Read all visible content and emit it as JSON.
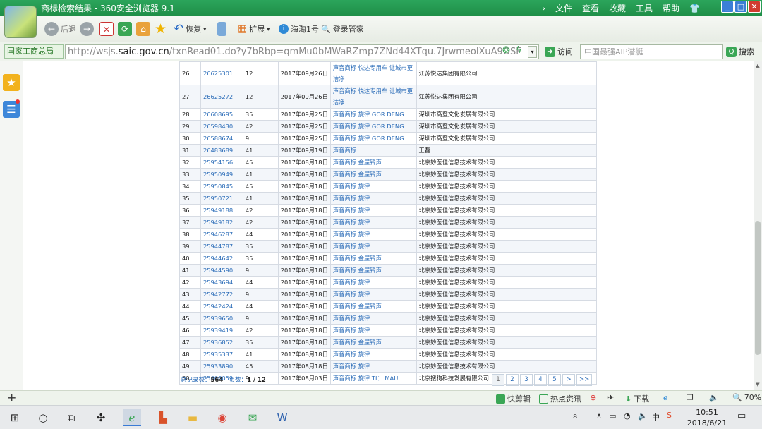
{
  "window": {
    "title": "商标检索结果 - 360安全浏览器 9.1",
    "menus": [
      "文件",
      "查看",
      "收藏",
      "工具",
      "帮助"
    ]
  },
  "toolbar": {
    "back": "后退",
    "restore": "恢复",
    "extend": "扩展",
    "haitao": "海淘1号",
    "login": "登录管家"
  },
  "address": {
    "site_tag": "国家工商总局",
    "url_prefix": "http://wsjs.",
    "url_domain": "saic.gov.cn",
    "url_rest": "/txnRead01.do?y7bRbp=qmMu0bMWaRZmp7ZNd44XTqu.7JrwmeolXuA9OSF",
    "visit": "访问",
    "search_placeholder": "中国最强AIP潜艇",
    "search_button": "搜索"
  },
  "rows": [
    {
      "no": "26",
      "reg": "26625301",
      "cls": "12",
      "date": "2017年09月26日",
      "name": "声音商标 悦达专用车 让城市更洁净",
      "applicant": "江苏悦达集团有限公司",
      "tall": true
    },
    {
      "no": "27",
      "reg": "26625272",
      "cls": "12",
      "date": "2017年09月26日",
      "name": "声音商标 悦达专用车 让城市更洁净",
      "applicant": "江苏悦达集团有限公司",
      "tall": true
    },
    {
      "no": "28",
      "reg": "26608695",
      "cls": "35",
      "date": "2017年09月25日",
      "name": "声音商标 旋律 GOR DENG",
      "applicant": "深圳市高登文化发展有限公司"
    },
    {
      "no": "29",
      "reg": "26598430",
      "cls": "42",
      "date": "2017年09月25日",
      "name": "声音商标 旋律 GOR DENG",
      "applicant": "深圳市高登文化发展有限公司"
    },
    {
      "no": "30",
      "reg": "26588674",
      "cls": "9",
      "date": "2017年09月25日",
      "name": "声音商标 旋律 GOR DENG",
      "applicant": "深圳市高登文化发展有限公司"
    },
    {
      "no": "31",
      "reg": "26483689",
      "cls": "41",
      "date": "2017年09月19日",
      "name": "声音商标",
      "applicant": "王磊"
    },
    {
      "no": "32",
      "reg": "25954156",
      "cls": "45",
      "date": "2017年08月18日",
      "name": "声音商标 金屋铃声",
      "applicant": "北京妙医佳信息技术有限公司"
    },
    {
      "no": "33",
      "reg": "25950949",
      "cls": "41",
      "date": "2017年08月18日",
      "name": "声音商标 金屋铃声",
      "applicant": "北京妙医佳信息技术有限公司"
    },
    {
      "no": "34",
      "reg": "25950845",
      "cls": "45",
      "date": "2017年08月18日",
      "name": "声音商标 旋律",
      "applicant": "北京妙医佳信息技术有限公司"
    },
    {
      "no": "35",
      "reg": "25950721",
      "cls": "41",
      "date": "2017年08月18日",
      "name": "声音商标 旋律",
      "applicant": "北京妙医佳信息技术有限公司"
    },
    {
      "no": "36",
      "reg": "25949188",
      "cls": "42",
      "date": "2017年08月18日",
      "name": "声音商标 旋律",
      "applicant": "北京妙医佳信息技术有限公司"
    },
    {
      "no": "37",
      "reg": "25949182",
      "cls": "42",
      "date": "2017年08月18日",
      "name": "声音商标 旋律",
      "applicant": "北京妙医佳信息技术有限公司"
    },
    {
      "no": "38",
      "reg": "25946287",
      "cls": "44",
      "date": "2017年08月18日",
      "name": "声音商标 旋律",
      "applicant": "北京妙医佳信息技术有限公司"
    },
    {
      "no": "39",
      "reg": "25944787",
      "cls": "35",
      "date": "2017年08月18日",
      "name": "声音商标 旋律",
      "applicant": "北京妙医佳信息技术有限公司"
    },
    {
      "no": "40",
      "reg": "25944642",
      "cls": "35",
      "date": "2017年08月18日",
      "name": "声音商标 金屋铃声",
      "applicant": "北京妙医佳信息技术有限公司"
    },
    {
      "no": "41",
      "reg": "25944590",
      "cls": "9",
      "date": "2017年08月18日",
      "name": "声音商标 金屋铃声",
      "applicant": "北京妙医佳信息技术有限公司"
    },
    {
      "no": "42",
      "reg": "25943694",
      "cls": "44",
      "date": "2017年08月18日",
      "name": "声音商标 旋律",
      "applicant": "北京妙医佳信息技术有限公司"
    },
    {
      "no": "43",
      "reg": "25942772",
      "cls": "9",
      "date": "2017年08月18日",
      "name": "声音商标 旋律",
      "applicant": "北京妙医佳信息技术有限公司"
    },
    {
      "no": "44",
      "reg": "25942424",
      "cls": "44",
      "date": "2017年08月18日",
      "name": "声音商标 金屋铃声",
      "applicant": "北京妙医佳信息技术有限公司"
    },
    {
      "no": "45",
      "reg": "25939650",
      "cls": "9",
      "date": "2017年08月18日",
      "name": "声音商标 旋律",
      "applicant": "北京妙医佳信息技术有限公司"
    },
    {
      "no": "46",
      "reg": "25939419",
      "cls": "42",
      "date": "2017年08月18日",
      "name": "声音商标 旋律",
      "applicant": "北京妙医佳信息技术有限公司"
    },
    {
      "no": "47",
      "reg": "25936852",
      "cls": "35",
      "date": "2017年08月18日",
      "name": "声音商标 金屋铃声",
      "applicant": "北京妙医佳信息技术有限公司"
    },
    {
      "no": "48",
      "reg": "25935337",
      "cls": "41",
      "date": "2017年08月18日",
      "name": "声音商标 旋律",
      "applicant": "北京妙医佳信息技术有限公司"
    },
    {
      "no": "49",
      "reg": "25933890",
      "cls": "45",
      "date": "2017年08月18日",
      "name": "声音商标 旋律",
      "applicant": "北京妙医佳信息技术有限公司"
    },
    {
      "no": "50",
      "reg": "25666059",
      "cls": "9",
      "date": "2017年08月03日",
      "name": "声音商标 旋律 TI： MAU",
      "applicant": "北京搜狗科技发展有限公司"
    }
  ],
  "pager": {
    "total_label": "总记录数：",
    "total": "564",
    "sep": " | ",
    "pages_label": "页数：",
    "pages": "1 / 12",
    "buttons": [
      "1",
      "2",
      "3",
      "4",
      "5",
      ">",
      ">>"
    ]
  },
  "statusbar": {
    "kuaijianji": "快剪辑",
    "hotnews": "热点资讯",
    "download": "下载",
    "zoom": "70%"
  },
  "taskbar": {
    "time": "10:51",
    "date": "2018/6/21",
    "ime": "中"
  },
  "colors": {
    "titlebar": "#1f8f48",
    "link": "#2b6cb8"
  }
}
